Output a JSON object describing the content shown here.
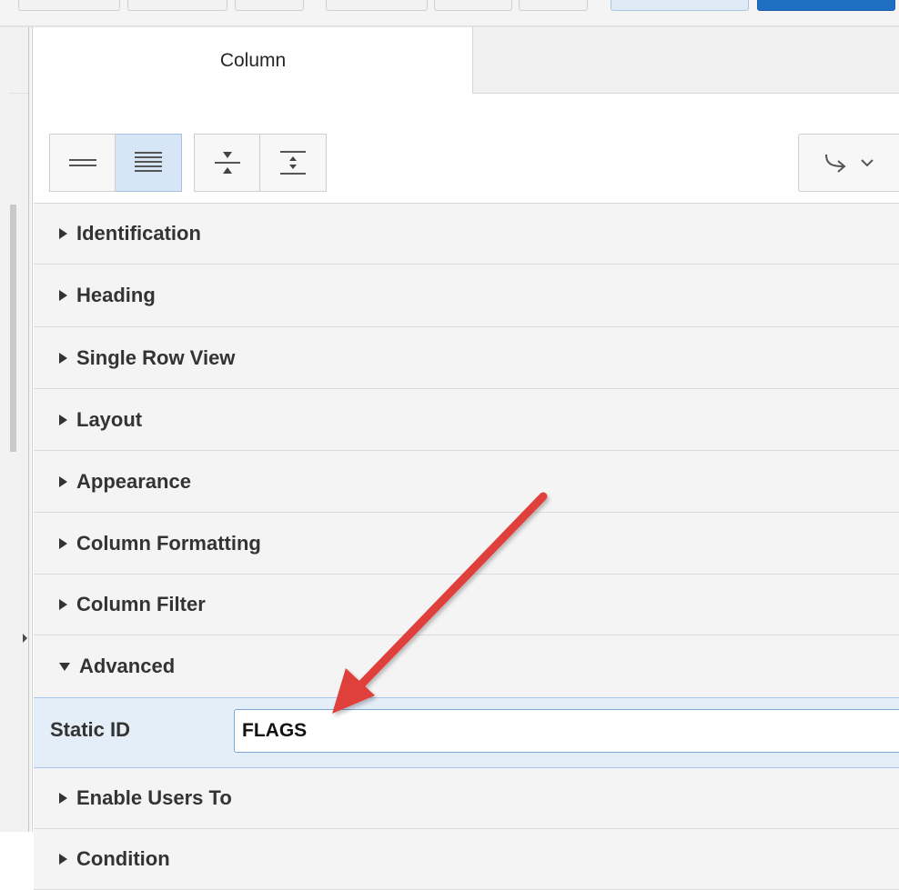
{
  "panel": {
    "tabs": [
      {
        "label": "Column",
        "active": true
      }
    ],
    "toolbar": {
      "buttons": [
        {
          "icon": "collapsed-lines-icon",
          "pressed": false
        },
        {
          "icon": "expanded-lines-icon",
          "pressed": true
        },
        {
          "icon": "collapse-all-icon",
          "pressed": false
        },
        {
          "icon": "expand-all-icon",
          "pressed": false
        }
      ],
      "go_to_group_icon": "go-to-group-icon"
    },
    "sections": [
      {
        "label": "Identification",
        "expanded": false
      },
      {
        "label": "Heading",
        "expanded": false
      },
      {
        "label": "Single Row View",
        "expanded": false
      },
      {
        "label": "Layout",
        "expanded": false
      },
      {
        "label": "Appearance",
        "expanded": false
      },
      {
        "label": "Column Formatting",
        "expanded": false
      },
      {
        "label": "Column Filter",
        "expanded": false
      },
      {
        "label": "Advanced",
        "expanded": true
      },
      {
        "label": "Enable Users To",
        "expanded": false
      },
      {
        "label": "Condition",
        "expanded": false
      }
    ],
    "static_id": {
      "label": "Static ID",
      "value": "FLAGS"
    }
  },
  "colors": {
    "selected_row": "#e4eef9",
    "annotation_arrow": "#e0403a",
    "pressed_button": "#d7e6f6"
  }
}
